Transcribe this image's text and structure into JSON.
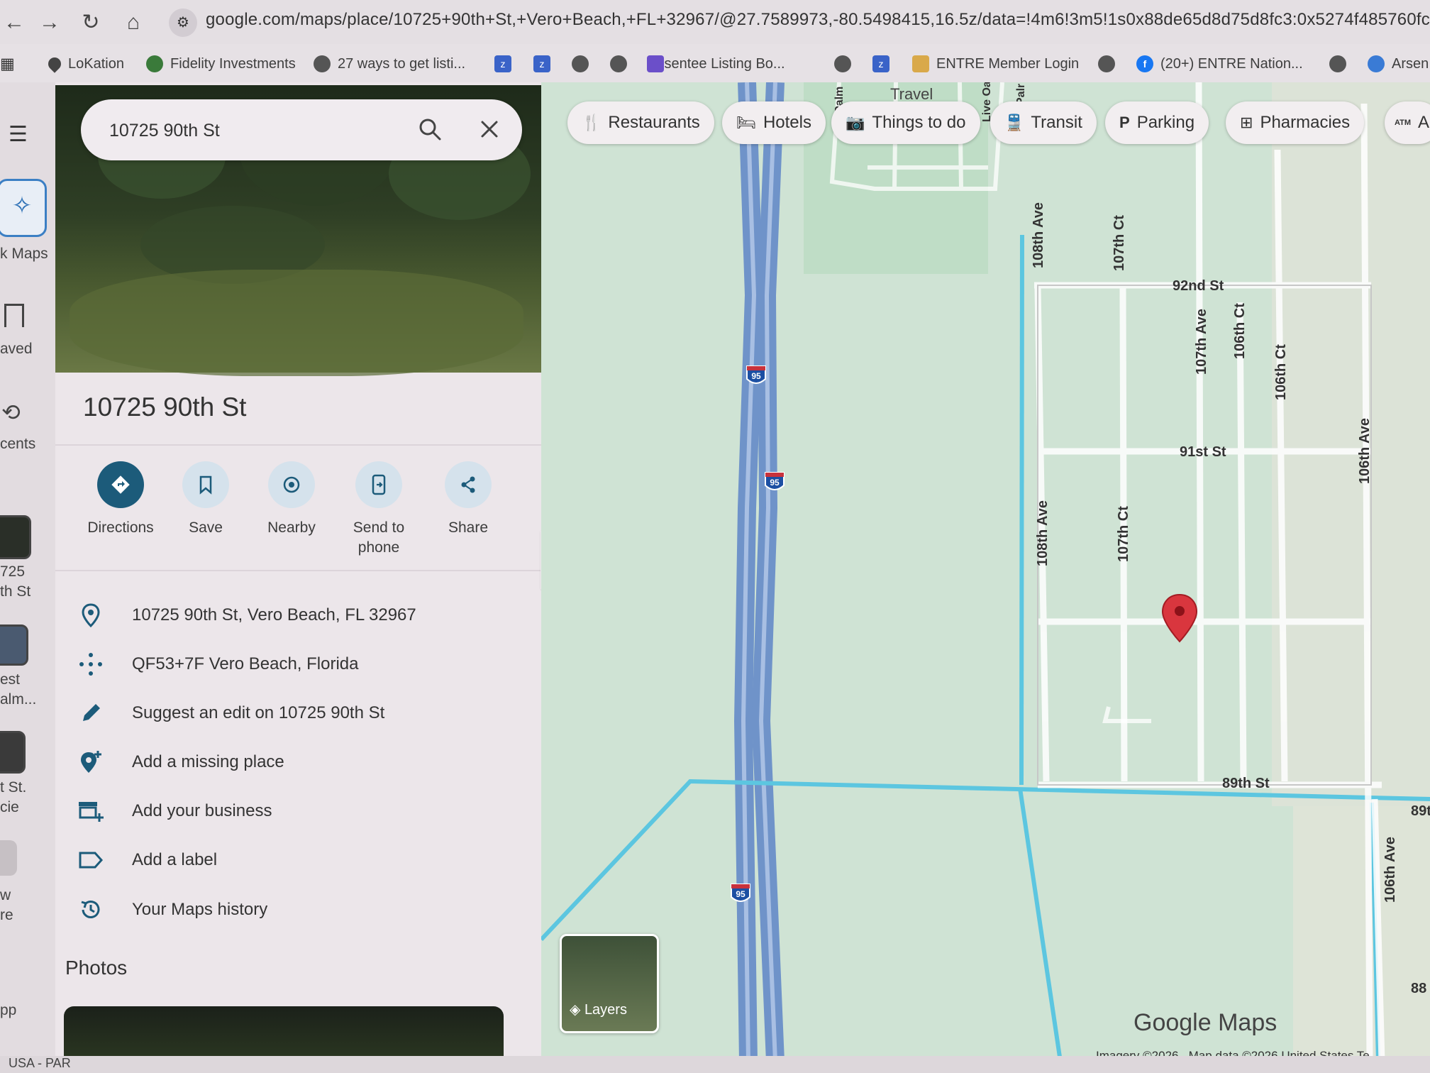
{
  "browser": {
    "url": "google.com/maps/place/10725+90th+St,+Vero+Beach,+FL+32967/@27.7589973,-80.5498415,16.5z/data=!4m6!3m5!1s0x88de65d8d75d8fc3:0x5274f485760fc16d!8",
    "bookmarks": [
      {
        "label": "LoKation",
        "icon": "pin-icon"
      },
      {
        "label": "Fidelity Investments",
        "icon": "fidelity-icon"
      },
      {
        "label": "27  ways to get listi...",
        "icon": "globe-icon"
      },
      {
        "label": "",
        "icon": "zillow-icon"
      },
      {
        "label": "",
        "icon": "zillow-icon"
      },
      {
        "label": "",
        "icon": "globe-icon"
      },
      {
        "label": "",
        "icon": "globe-icon"
      },
      {
        "label": "Absentee Listing Bo...",
        "icon": "app-icon"
      },
      {
        "label": "",
        "icon": "globe-icon"
      },
      {
        "label": "",
        "icon": "zillow-icon"
      },
      {
        "label": "ENTRE Member Login",
        "icon": "entre-icon"
      },
      {
        "label": "",
        "icon": "globe-icon"
      },
      {
        "label": "(20+) ENTRE Nation...",
        "icon": "facebook-icon"
      },
      {
        "label": "",
        "icon": "globe-icon"
      },
      {
        "label": "Arsen",
        "icon": "app-icon"
      }
    ]
  },
  "rail": {
    "items": [
      "k Maps",
      "aved",
      "cents",
      "725",
      "th St",
      "est",
      "alm...",
      "t St.",
      "cie",
      "w",
      "re",
      "pp"
    ]
  },
  "panel": {
    "search_value": "10725 90th St",
    "title": "10725 90th St",
    "actions": [
      "Directions",
      "Save",
      "Nearby",
      "Send to\nphone",
      "Share"
    ],
    "info": [
      {
        "text": "10725 90th St, Vero Beach, FL 32967",
        "icon": "location-pin-icon"
      },
      {
        "text": "QF53+7F Vero Beach, Florida",
        "icon": "plus-code-icon"
      },
      {
        "text": "Suggest an edit on 10725 90th St",
        "icon": "pencil-icon"
      },
      {
        "text": "Add a missing place",
        "icon": "add-place-icon"
      },
      {
        "text": "Add your business",
        "icon": "add-business-icon"
      },
      {
        "text": "Add a label",
        "icon": "label-icon"
      },
      {
        "text": "Your Maps history",
        "icon": "history-icon"
      }
    ],
    "photos_title": "Photos"
  },
  "map": {
    "chips": [
      "Restaurants",
      "Hotels",
      "Things to do",
      "Transit",
      "Parking",
      "Pharmacies",
      "A"
    ],
    "streets": [
      "92nd St",
      "91st St",
      "89th St",
      "108th Ave",
      "107th Ct",
      "107th Ave",
      "106th Ct",
      "106th Ct",
      "106th Ave",
      "108th Ave",
      "107th Ct",
      "106th Ave",
      "89t",
      "88",
      "Travel",
      "Palm",
      "Live Oa",
      "Palr"
    ],
    "highway_shield": "95",
    "layers_label": "Layers",
    "logo": "Google Maps",
    "attribution": "Imagery ©2026 , Map data ©2026     United States     Te"
  },
  "status": "USA - PAR",
  "colors": {
    "directions": "#1c5b7a",
    "action_circle": "#d5e2ec",
    "water": "#5cc6e0",
    "interstate": "#6f93c9",
    "pin": "#d9363e",
    "map_base": "#c8dccf"
  }
}
